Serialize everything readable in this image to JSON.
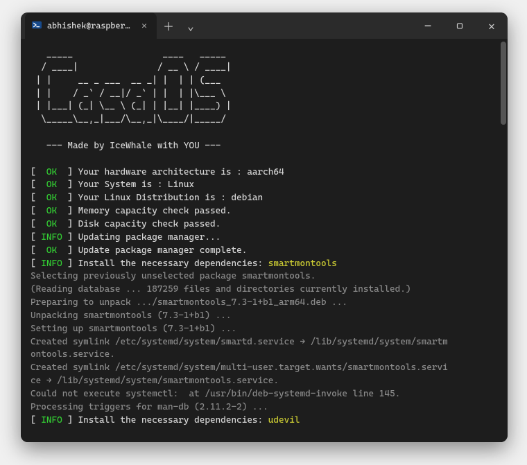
{
  "window": {
    "tab_title": "abhishek@raspberrypi: ~",
    "tab_close_glyph": "✕",
    "newtab_glyph": "＋",
    "tabmenu_glyph": "⌄",
    "minimize_glyph": "—",
    "maximize_glyph": "▢",
    "close_glyph": "✕"
  },
  "ascii": {
    "l1": "   _____                 ____   _____ ",
    "l2": "  / ____|               / __ \\ / ____|",
    "l3": " | |     __ _ ___  __ _| |  | | (___  ",
    "l4": " | |    / _` / __|/ _` | |  | |\\___ \\ ",
    "l5": " | |___| (_| \\__ \\ (_| | |__| |____) |",
    "l6": "  \\_____\\__,_|___/\\__,_|\\____/|_____/ ",
    "l7": "                                      "
  },
  "tagline": "   --- Made by IceWhale with YOU ---",
  "status": {
    "brkt_open": "[ ",
    "brkt_mid": " ] ",
    "ok": " OK ",
    "info": "INFO"
  },
  "lines": {
    "s1": "Your hardware architecture is : aarch64",
    "s2": "Your System is : Linux",
    "s3": "Your Linux Distribution is : debian",
    "s4": "Memory capacity check passed.",
    "s5": "Disk capacity check passed.",
    "s6": "Updating package manager...",
    "s7": "Update package manager complete.",
    "s8": "Install the necessary dependencies: ",
    "dep1": "smartmontools",
    "dep2": "udevil"
  },
  "apt": {
    "l1": "Selecting previously unselected package smartmontools.",
    "l2": "(Reading database ... 187259 files and directories currently installed.)",
    "l3": "Preparing to unpack .../smartmontools_7.3-1+b1_arm64.deb ...",
    "l4": "Unpacking smartmontools (7.3-1+b1) ...",
    "l5": "Setting up smartmontools (7.3-1+b1) ...",
    "l6": "Created symlink /etc/systemd/system/smartd.service → /lib/systemd/system/smartm",
    "l7": "ontools.service.",
    "l8": "Created symlink /etc/systemd/system/multi-user.target.wants/smartmontools.servi",
    "l9": "ce → /lib/systemd/system/smartmontools.service.",
    "l10": "Could not execute systemctl:  at /usr/bin/deb-systemd-invoke line 145.",
    "l11": "Processing triggers for man-db (2.11.2-2) ..."
  }
}
